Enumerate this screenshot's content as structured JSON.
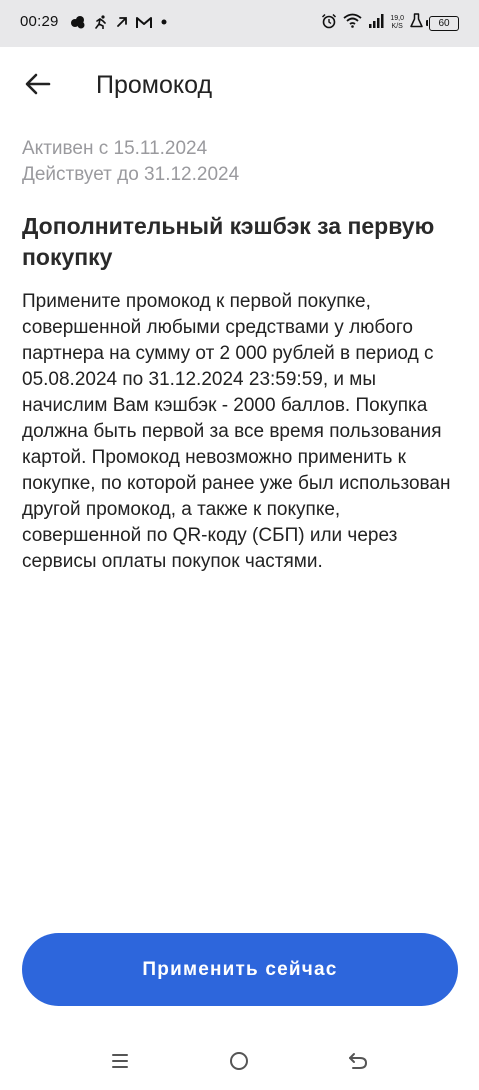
{
  "status_bar": {
    "time": "00:29",
    "net_speed_value": "19,0",
    "net_speed_unit": "K/S",
    "battery_level": "60",
    "left_icons": [
      "cloud-icon",
      "running-icon",
      "arrow-icon",
      "mail-icon",
      "dot-icon"
    ],
    "right_icons": [
      "alarm-icon",
      "wifi-icon",
      "signal-icon",
      "flask-icon",
      "battery-icon"
    ]
  },
  "header": {
    "back_icon": "arrow-left-icon",
    "title": "Промокод"
  },
  "promo": {
    "active_from": "Активен с 15.11.2024",
    "valid_until": "Действует до 31.12.2024",
    "heading": "Дополнительный кэшбэк за первую покупку",
    "description": "Примените промокод к первой покупке, совершенной любыми средствами у любого партнера на сумму от 2 000 рублей в период с 05.08.2024 по 31.12.2024 23:59:59, и мы начислим Вам кэшбэк - 2000 баллов. Покупка должна быть первой за все время пользования картой. Промокод невозможно применить к покупке, по которой ранее уже был использован другой промокод, а также к покупке, совершенной по QR-коду (СБП) или через сервисы оплаты покупок частями."
  },
  "actions": {
    "apply_label": "Применить сейчас",
    "apply_color": "#2d66dc"
  },
  "nav_bar": {
    "icons": [
      "menu-icon",
      "home-circle-icon",
      "back-arrow-icon"
    ]
  }
}
